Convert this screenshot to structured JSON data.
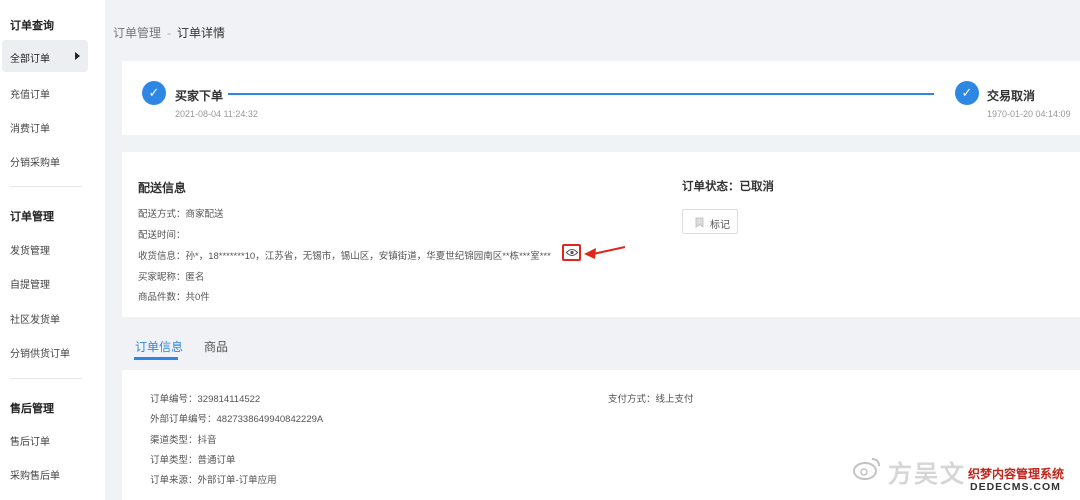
{
  "sidebar": {
    "groups": [
      {
        "title": "订单查询",
        "items": [
          {
            "label": "全部订单",
            "active": true
          },
          {
            "label": "充值订单"
          },
          {
            "label": "消费订单"
          },
          {
            "label": "分销采购单"
          }
        ]
      },
      {
        "title": "订单管理",
        "items": [
          {
            "label": "发货管理"
          },
          {
            "label": "自提管理"
          },
          {
            "label": "社区发货单"
          },
          {
            "label": "分销供货订单"
          }
        ]
      },
      {
        "title": "售后管理",
        "items": [
          {
            "label": "售后订单"
          },
          {
            "label": "采购售后单"
          }
        ]
      }
    ]
  },
  "breadcrumb": {
    "parent": "订单管理",
    "separator": "-",
    "current": "订单详情"
  },
  "progress": {
    "steps": [
      {
        "title": "买家下单",
        "time": "2021-08-04 11:24:32"
      },
      {
        "title": "交易取消",
        "time": "1970-01-20 04:14:09"
      }
    ],
    "accent_color": "#2f87e4"
  },
  "delivery": {
    "title": "配送信息",
    "rows": [
      {
        "text": "配送方式：商家配送"
      },
      {
        "text": "配送时间："
      },
      {
        "text": "收货信息：孙*，18*******10，江苏省，无锡市，锡山区，安镇街道，华夏世纪锦园南区**栋***室***"
      },
      {
        "text": "买家昵称：匿名"
      },
      {
        "text": "商品件数：共0件"
      }
    ],
    "reveal_icon": "eye-icon",
    "highlight_color": "#e1261c"
  },
  "order_status": {
    "text": "订单状态：已取消",
    "mark_label": "标记",
    "mark_icon": "bookmark-icon"
  },
  "tabs": [
    {
      "label": "订单信息",
      "active": true
    },
    {
      "label": "商品",
      "active": false
    }
  ],
  "order_info": {
    "left": [
      "订单编号：329814114522",
      "外部订单编号：4827338649940842229A",
      "渠道类型：抖音",
      "订单类型：普通订单",
      "订单来源：外部订单-订单应用"
    ],
    "right": [
      "支付方式：线上支付"
    ]
  },
  "watermark": {
    "brand": "方吴文",
    "cms_name": "织梦内容管理系统",
    "cms_url": "DEDECMS.COM"
  }
}
